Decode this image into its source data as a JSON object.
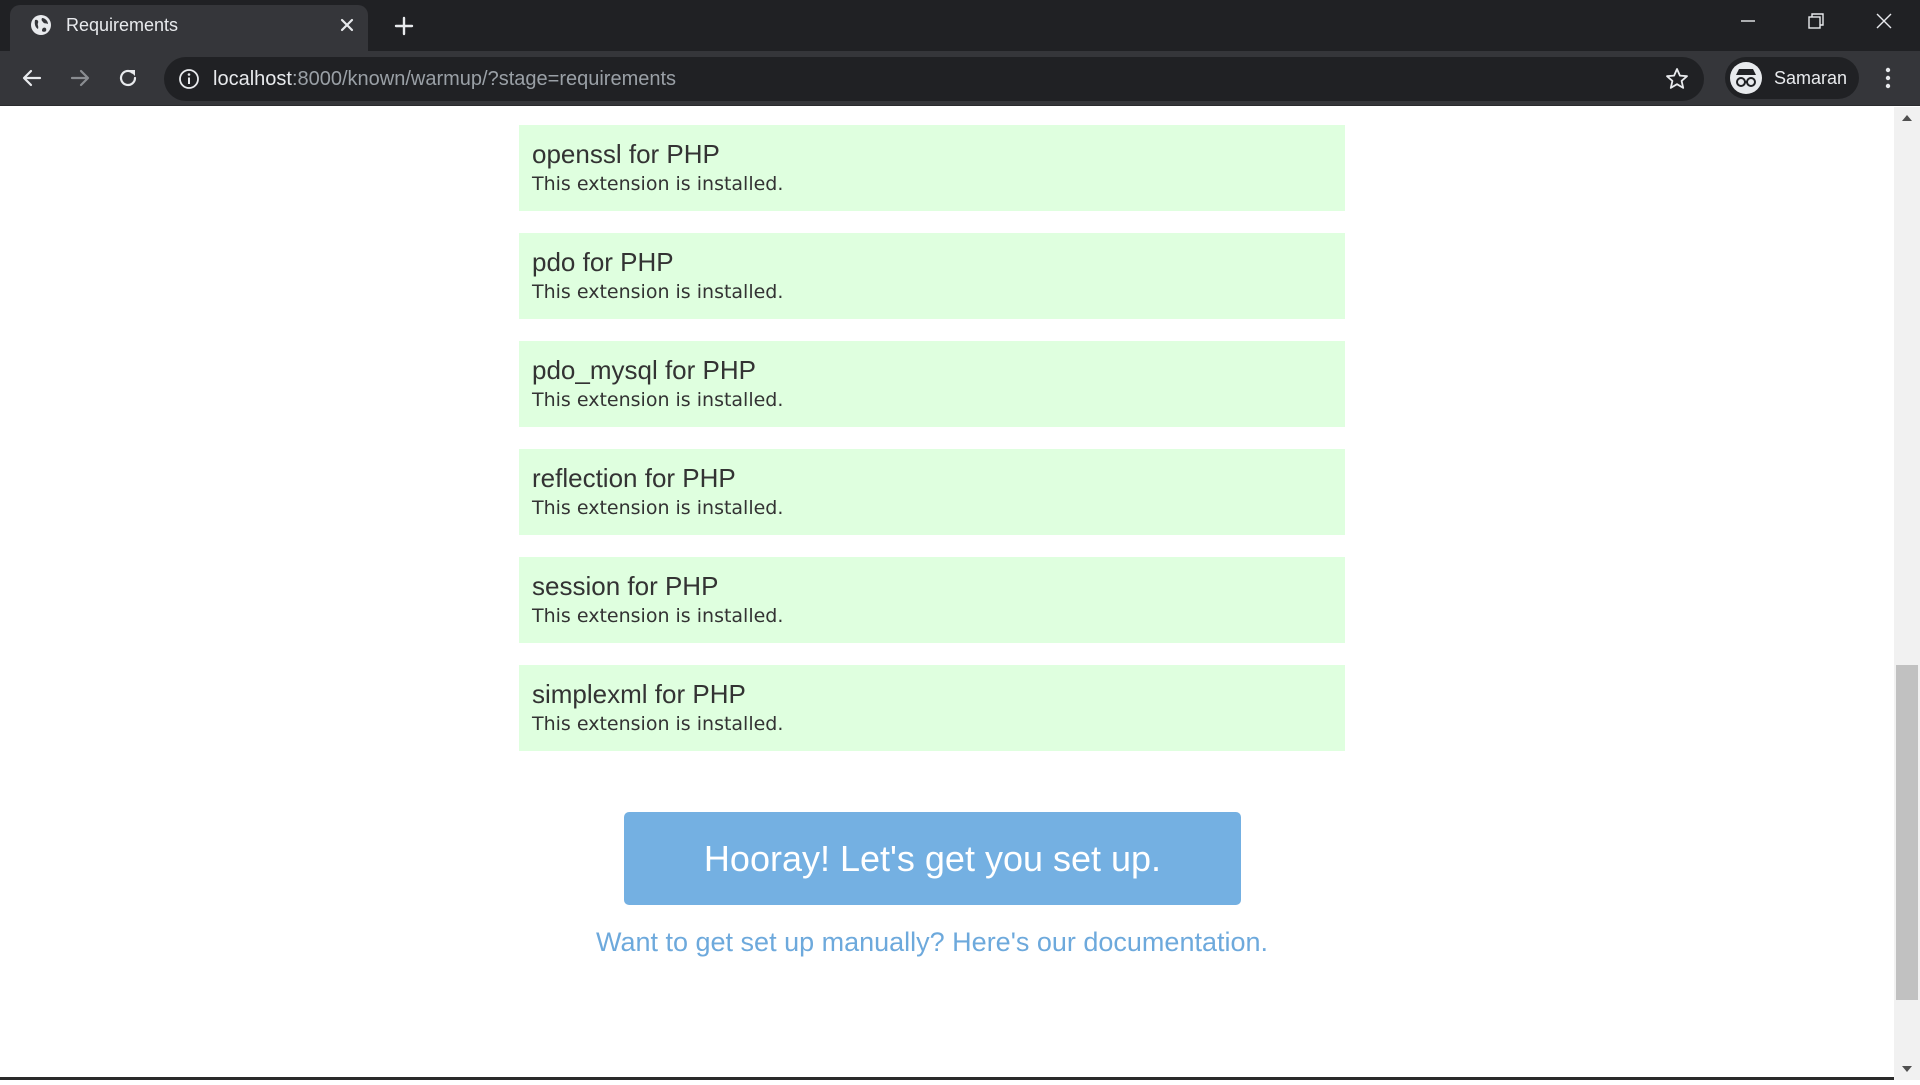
{
  "browser": {
    "tab_title": "Requirements",
    "url_host": "localhost",
    "url_path": ":8000/known/warmup/?stage=requirements",
    "profile_name": "Samaran",
    "icons": [
      "globe-icon",
      "close-icon",
      "plus-icon",
      "back-icon",
      "forward-icon",
      "reload-icon",
      "info-icon",
      "star-icon",
      "incognito-icon",
      "more-icon",
      "minimize-icon",
      "restore-icon"
    ]
  },
  "requirements": [
    {
      "title": "openssl for PHP",
      "status": "This extension is installed."
    },
    {
      "title": "pdo for PHP",
      "status": "This extension is installed."
    },
    {
      "title": "pdo_mysql for PHP",
      "status": "This extension is installed."
    },
    {
      "title": "reflection for PHP",
      "status": "This extension is installed."
    },
    {
      "title": "session for PHP",
      "status": "This extension is installed."
    },
    {
      "title": "simplexml for PHP",
      "status": "This extension is installed."
    }
  ],
  "actions": {
    "setup_button": "Hooray! Let's get you set up.",
    "doc_link": "Want to get set up manually? Here's our documentation."
  },
  "colors": {
    "success_bg": "#dfffdf",
    "button_bg": "#74b0e2",
    "link": "#6da9dc"
  }
}
